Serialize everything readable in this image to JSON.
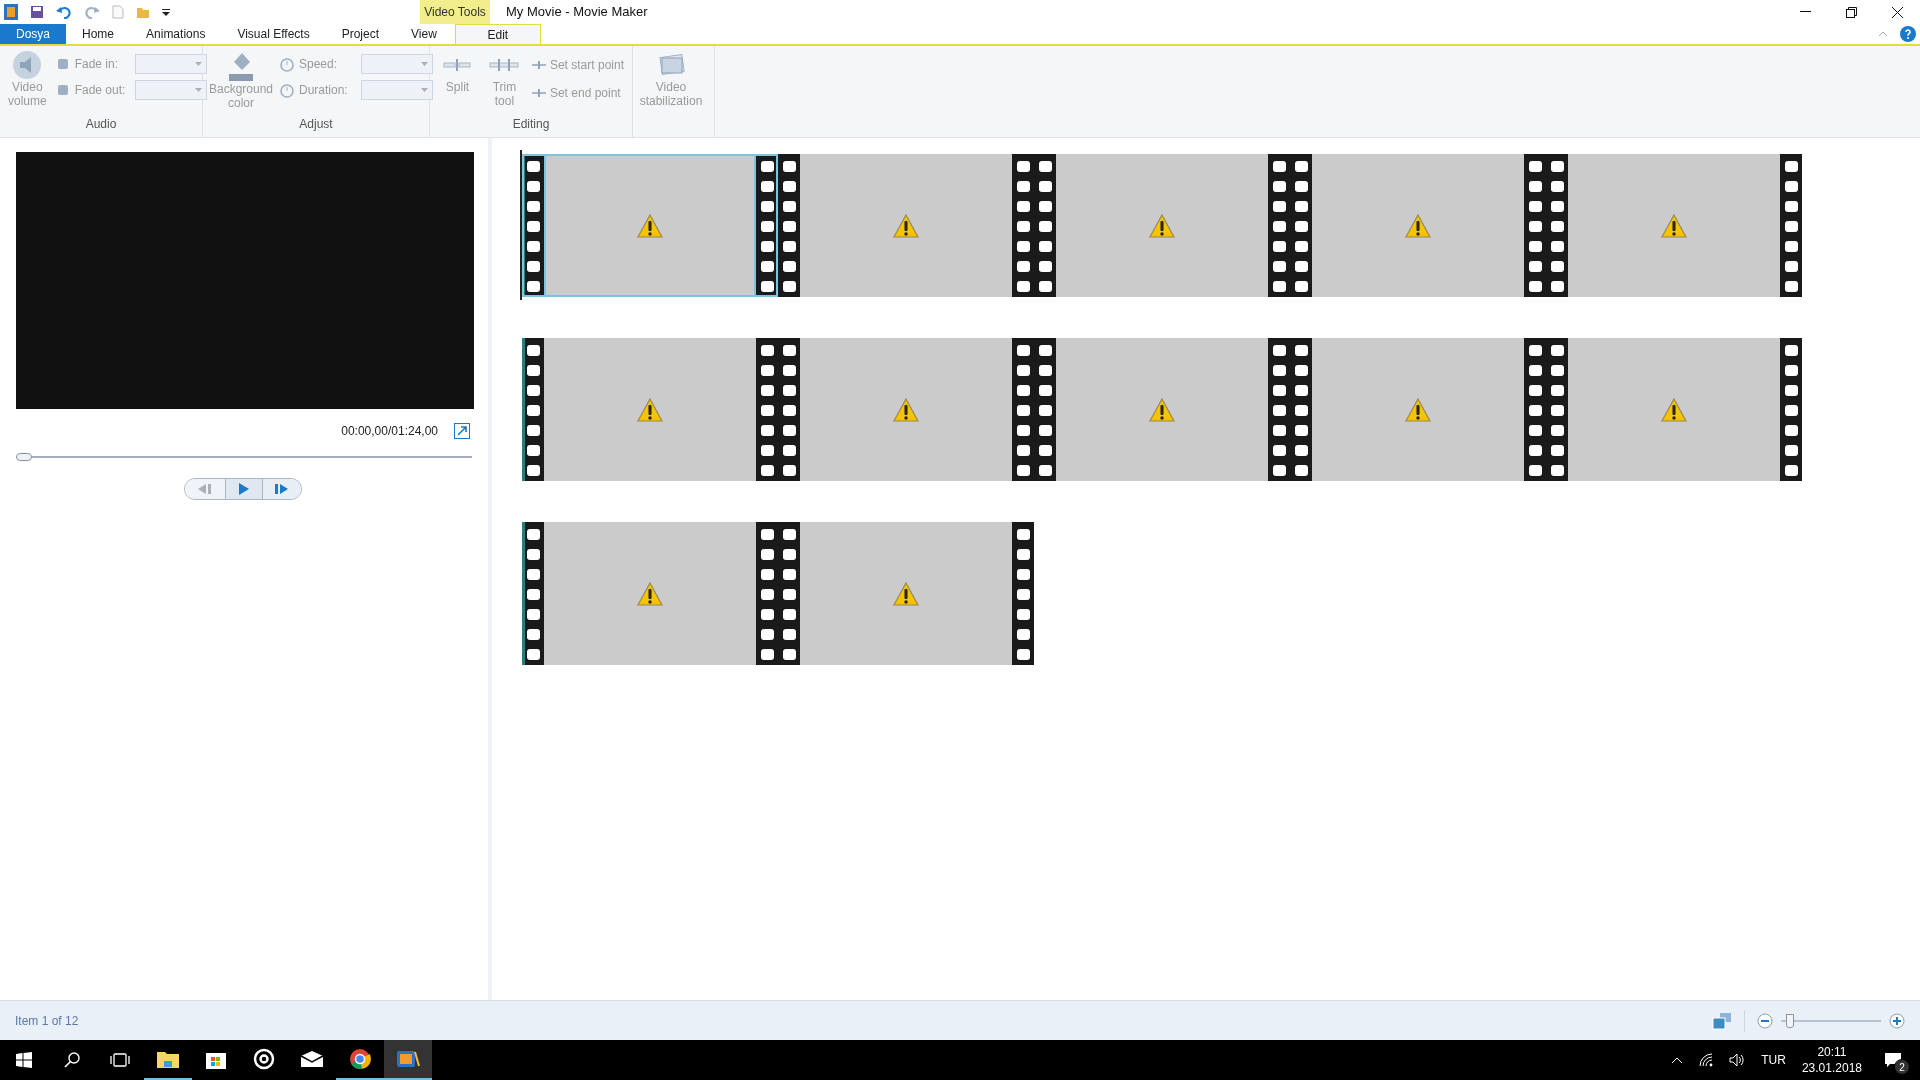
{
  "window": {
    "title": "My Movie - Movie Maker",
    "contextual_label": "Video Tools"
  },
  "tabs": [
    {
      "label": "Dosya",
      "kind": "file",
      "selected": false
    },
    {
      "label": "Home",
      "kind": "tab",
      "selected": false
    },
    {
      "label": "Animations",
      "kind": "tab",
      "selected": false
    },
    {
      "label": "Visual Effects",
      "kind": "tab",
      "selected": false
    },
    {
      "label": "Project",
      "kind": "tab",
      "selected": false
    },
    {
      "label": "View",
      "kind": "tab",
      "selected": false
    },
    {
      "label": "Edit",
      "kind": "contextual",
      "selected": true
    }
  ],
  "ribbon": {
    "audio": {
      "label": "Audio",
      "video_volume": {
        "label": "Video volume",
        "disabled": true
      },
      "fade_in": {
        "label": "Fade in:",
        "disabled": true
      },
      "fade_out": {
        "label": "Fade out:",
        "disabled": true
      }
    },
    "adjust": {
      "label": "Adjust",
      "background_color": {
        "label": "Background color",
        "disabled": true
      },
      "speed": {
        "label": "Speed:",
        "disabled": true
      },
      "duration": {
        "label": "Duration:",
        "disabled": true
      }
    },
    "editing": {
      "label": "Editing",
      "split": {
        "label": "Split",
        "disabled": true
      },
      "trim_tool": {
        "label": "Trim tool",
        "disabled": true
      },
      "set_start_point": {
        "label": "Set start point",
        "disabled": true
      },
      "set_end_point": {
        "label": "Set end point",
        "disabled": true
      }
    },
    "stabilization": {
      "label": "Video stabilization",
      "disabled": true
    }
  },
  "preview": {
    "time": "00:00,00/01:24,00",
    "seek": {
      "level": 0
    }
  },
  "clips": [
    {
      "selected": true
    },
    {
      "selected": false
    },
    {
      "selected": false
    },
    {
      "selected": false
    },
    {
      "selected": false
    },
    {
      "selected": false
    },
    {
      "selected": false
    },
    {
      "selected": false
    },
    {
      "selected": false
    },
    {
      "selected": false
    },
    {
      "selected": false
    },
    {
      "selected": false
    }
  ],
  "status_bar": {
    "text": "Item 1 of 12",
    "zoom": {
      "level": 0.05
    }
  },
  "taskbar": {
    "apps": [
      {
        "kind": "explorer",
        "running": true,
        "selected": false
      },
      {
        "kind": "store",
        "running": false,
        "selected": false
      },
      {
        "kind": "groove",
        "running": false,
        "selected": false
      },
      {
        "kind": "mail",
        "running": false,
        "selected": false
      },
      {
        "kind": "chrome",
        "running": true,
        "selected": false
      },
      {
        "kind": "moviemaker",
        "running": true,
        "selected": true
      }
    ],
    "language": "TUR",
    "time": "20:11",
    "date": "23.01.2018",
    "notifications": "2"
  }
}
